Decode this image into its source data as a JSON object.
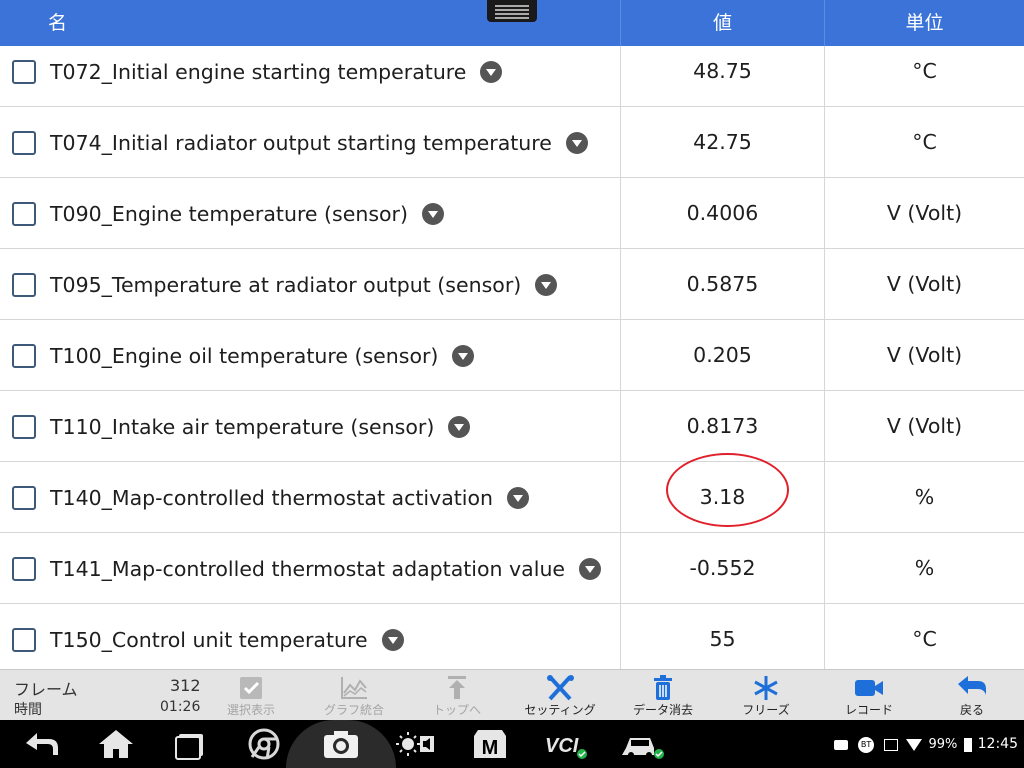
{
  "header": {
    "col_name": "名",
    "col_value": "値",
    "col_unit": "単位"
  },
  "rows": [
    {
      "name": "T072_Initial engine starting temperature",
      "value": "48.75",
      "unit": "°C"
    },
    {
      "name": "T074_Initial radiator output starting temperature",
      "value": "42.75",
      "unit": "°C"
    },
    {
      "name": "T090_Engine temperature (sensor)",
      "value": "0.4006",
      "unit": "V (Volt)"
    },
    {
      "name": "T095_Temperature at radiator output (sensor)",
      "value": "0.5875",
      "unit": "V (Volt)"
    },
    {
      "name": "T100_Engine oil temperature (sensor)",
      "value": "0.205",
      "unit": "V (Volt)"
    },
    {
      "name": "T110_Intake air temperature (sensor)",
      "value": "0.8173",
      "unit": "V (Volt)"
    },
    {
      "name": "T140_Map-controlled thermostat activation",
      "value": "3.18",
      "unit": "%"
    },
    {
      "name": "T141_Map-controlled thermostat adaptation value",
      "value": "-0.552",
      "unit": "%"
    },
    {
      "name": "T150_Control unit temperature",
      "value": "55",
      "unit": "°C"
    }
  ],
  "frame": {
    "frame_label": "フレーム",
    "frame_value": "312",
    "time_label": "時間",
    "time_value": "01:26"
  },
  "toolbar": {
    "select_view": "選択表示",
    "graph_merge": "グラフ統合",
    "to_top": "トップへ",
    "setting": "セッティング",
    "clear_data": "データ消去",
    "freeze": "フリーズ",
    "record": "レコード",
    "back": "戻る"
  },
  "status": {
    "battery": "99%",
    "time": "12:45",
    "bt": "BT"
  },
  "colors": {
    "header_blue": "#3b73d9",
    "accent_blue": "#1e6fd9",
    "highlight_red": "#e0202a"
  }
}
